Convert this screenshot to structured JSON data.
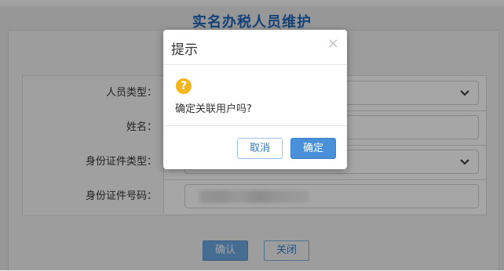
{
  "page": {
    "title": "实名办税人员维护"
  },
  "form": {
    "rows": [
      {
        "label": "人员类型：",
        "type": "select",
        "value": ""
      },
      {
        "label": "姓名：",
        "type": "text",
        "value": ""
      },
      {
        "label": "身份证件类型：",
        "type": "select",
        "value": ""
      },
      {
        "label": "身份证件号码：",
        "type": "text",
        "value": ""
      }
    ]
  },
  "footer": {
    "confirm_label": "确认",
    "close_label": "关闭"
  },
  "dialog": {
    "title": "提示",
    "close_glyph": "×",
    "icon": "question-warning-icon",
    "icon_glyph": "?",
    "message": "确定关联用户吗?",
    "cancel_label": "取消",
    "ok_label": "确定"
  },
  "colors": {
    "title_blue": "#1f66b8",
    "primary_button": "#4a90d9",
    "warning_icon": "#f2b51a"
  }
}
